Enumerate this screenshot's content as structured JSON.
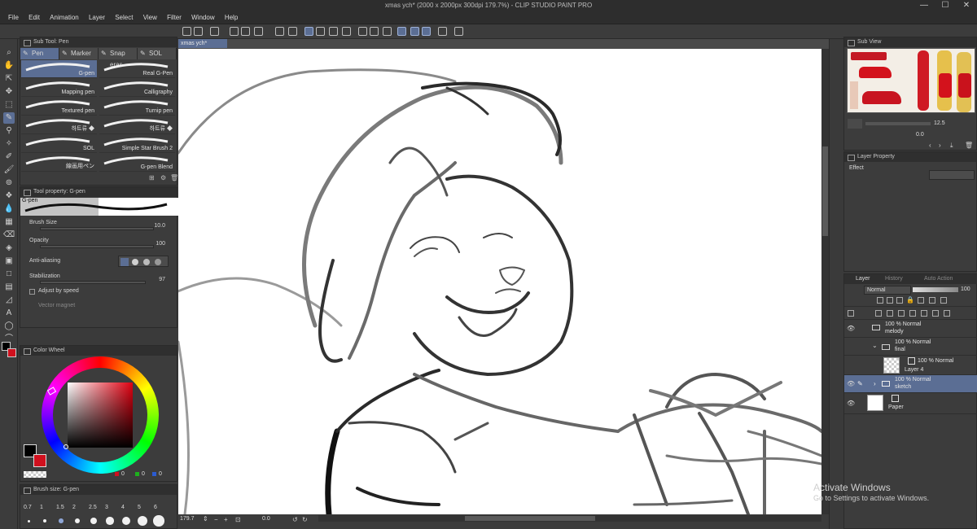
{
  "window": {
    "title": "xmas ych* (2000 x 2000px 300dpi 179.7%) - CLIP STUDIO PAINT PRO",
    "minimize": "—",
    "maximize": "☐",
    "close": "✕"
  },
  "menu": [
    "File",
    "Edit",
    "Animation",
    "Layer",
    "Select",
    "View",
    "Filter",
    "Window",
    "Help"
  ],
  "subtool_panel": {
    "header": "Sub Tool: Pen",
    "tabs": [
      "Pen",
      "Marker",
      "Snap eras",
      "SOL"
    ],
    "brushes": [
      {
        "label": "G-pen",
        "selected": true
      },
      {
        "label": "Real G-Pen",
        "selected": false
      },
      {
        "label": "Mapping pen",
        "selected": false
      },
      {
        "label": "Calligraphy",
        "selected": false
      },
      {
        "label": "Textured pen",
        "selected": false
      },
      {
        "label": "Turnip pen",
        "selected": false
      },
      {
        "label": "하트류 ◆",
        "selected": false
      },
      {
        "label": "하트류 ◆",
        "selected": false
      },
      {
        "label": "SOL",
        "selected": false
      },
      {
        "label": "Simple Star Brush 2",
        "selected": false
      },
      {
        "label": "線画用ペン",
        "selected": false
      },
      {
        "label": "G-pen Blend",
        "selected": false
      }
    ]
  },
  "tool_property": {
    "header": "Tool property: G-pen",
    "preview_label": "G-pen",
    "brush_size_label": "Brush Size",
    "brush_size_value": "10.0",
    "opacity_label": "Opacity",
    "opacity_value": "100",
    "antialias_label": "Anti-aliasing",
    "stabilization_label": "Stabilization",
    "stabilization_value": "97",
    "adjust_speed_label": "Adjust by speed",
    "vector_magnet_label": "Vector magnet"
  },
  "color_wheel": {
    "header": "Color Wheel",
    "main_color": "#000000",
    "sub_color": "#d0101e",
    "values": [
      "0",
      "0",
      "0"
    ]
  },
  "brush_size_panel": {
    "header": "Brush size: G-pen",
    "sizes": [
      "0.7",
      "1",
      "1.5",
      "2",
      "2.5",
      "3",
      "4",
      "5",
      "6"
    ]
  },
  "document": {
    "tab": "xmas ych*",
    "zoom": "179.7",
    "rotation": "0.0"
  },
  "subview": {
    "header": "Sub View",
    "zoom": "12.5",
    "angle": "0.0"
  },
  "layer_property": {
    "header": "Layer Property",
    "effect_label": "Effect"
  },
  "layer_panel": {
    "tabs": [
      "Layer",
      "History",
      "Auto Action"
    ],
    "blend_mode": "Normal",
    "opacity": "100",
    "layers": [
      {
        "line1": "100 % Normal",
        "line2": "melody",
        "type": "folder"
      },
      {
        "line1": "100 % Normal",
        "line2": "final",
        "type": "folder"
      },
      {
        "line1": "100 % Normal",
        "line2": "Layer 4",
        "type": "raster"
      },
      {
        "line1": "100 % Normal",
        "line2": "sketch",
        "type": "folder"
      },
      {
        "line1": "",
        "line2": "Paper",
        "type": "paper"
      }
    ]
  },
  "watermark": {
    "line1": "Activate Windows",
    "line2": "Go to Settings to activate Windows."
  },
  "colors": {
    "accent": "#5b6e94",
    "panel": "#3c3c3c",
    "header": "#2f2f2f"
  }
}
